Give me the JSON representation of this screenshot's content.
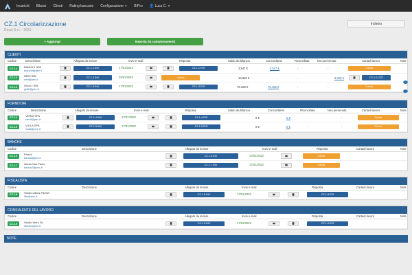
{
  "nav": {
    "items": [
      {
        "label": "Incarichi"
      },
      {
        "label": "Bilanci"
      },
      {
        "label": "Clienti"
      },
      {
        "label": "Rating bancario"
      },
      {
        "label": "Configurazione"
      },
      {
        "label": "BIPro"
      },
      {
        "label": "Luca C."
      }
    ]
  },
  "page": {
    "title": "CZ.1 Circolarizzazione",
    "subtitle": "Rossi S.r.l. - 2021",
    "back_label": "Indietro",
    "add_label": "+ Aggiungi",
    "import_label": "Importa da campionamenti"
  },
  "icons": {
    "doc": "document-icon",
    "mail": "envelope-icon",
    "comment": "comment-icon",
    "user": "user-icon"
  },
  "colors": {
    "navbar": "#2b2b2b",
    "panel_header": "#2a5f93",
    "code_green": "#2fa35a",
    "blue_btn": "#2a6099",
    "orange_btn": "#f0a030"
  },
  "clienti": {
    "header": "CLIENTI",
    "columns": {
      "codice": "Codice",
      "descrizione": "Descrizione",
      "allegato": "Allegato da inviare",
      "invio": "Invio e-mail",
      "risposta": "Risposta",
      "saldo": "Saldo da bilancio",
      "concordante": "Concordante",
      "riconciliata": "Riconciliata",
      "non_pervenuta": "Non pervenuta",
      "cartadi": "Cartadi lavoro",
      "note": "Note"
    },
    "rows": [
      {
        "code": "CZ.1.1",
        "name": "BIANCHI SPA",
        "email": "bianchi@pec.it",
        "inv": "CZ.1.1.INV",
        "date": "17/01/2022",
        "ris": "CZ.1.1.RIS",
        "saldo": "3.547 €",
        "conc": "3.547 €",
        "ric": "-",
        "np": "-",
        "carica": "Carica",
        "ris_pending": "",
        "crt": "",
        "has_note": false
      },
      {
        "code": "CZ.1.2",
        "name": "NERI SRL",
        "email": "neri@pec.it",
        "inv": "CZ.1.2.INV",
        "date": "25/01/2022",
        "ris": "",
        "saldo": "10.620 €",
        "conc": "-",
        "ric": "-",
        "np": "3.310 €",
        "carica": "",
        "ris_pending": "Carica",
        "crt": "CZ.1.2.CRT",
        "has_note": true
      },
      {
        "code": "CZ.1.3",
        "name": "GIALLI SRL",
        "email": "gialli@pec.it",
        "inv": "CZ.1.3.INV",
        "date": "17/01/2022",
        "ris": "CZ.1.3.RIS",
        "saldo": "75.159 €",
        "conc": "75.159 €",
        "ric": "-",
        "np": "-",
        "carica": "Carica",
        "ris_pending": "",
        "crt": "",
        "has_note": true
      }
    ]
  },
  "fornitori": {
    "header": "FORNITORI",
    "columns": {
      "codice": "Codice",
      "descrizione": "Descrizione",
      "allegato": "Allegato da inviare",
      "invio": "Invio e-mail",
      "risposta": "Risposta",
      "saldo": "Saldo da bilancio",
      "concordante": "Concordante",
      "riconciliata": "Riconciliata",
      "non_pervenuta": "Non pervenuta",
      "cartadi": "Cartadi lavoro",
      "note": "Note"
    },
    "rows": [
      {
        "code": "CZ.1.4",
        "name": "VERDI SPA",
        "email": "verdi@pec.it",
        "inv": "CZ.1.4.INV",
        "date": "17/01/2022",
        "ris": "CZ.1.4.RIS",
        "saldo": "0 €",
        "conc": "0 €",
        "ric": "-",
        "np": "-",
        "carica": "Carica"
      },
      {
        "code": "CZ.1.5",
        "name": "VIOLA SPA",
        "email": "viola@pec.it",
        "inv": "CZ.1.5.INV",
        "date": "17/01/2022",
        "ris": "CZ.1.5.RIS",
        "saldo": "0 €",
        "conc": "0 €",
        "ric": "-",
        "np": "-",
        "carica": "Carica"
      }
    ]
  },
  "banche": {
    "header": "BANCHE",
    "columns": {
      "codice": "Codice",
      "descrizione": "Descrizione",
      "allegato": "Allegato da inviare",
      "invio": "Invio e-mail",
      "risposta": "Risposta",
      "cartadi": "Cartadi lavoro",
      "note": "Note"
    },
    "rows": [
      {
        "code": "CZ.1.6",
        "name": "Fineco",
        "email": "banca@pec.it",
        "inv": "CZ.1.6.INV",
        "date": "17/01/2022",
        "carica": "Carica"
      },
      {
        "code": "CZ.1.7",
        "name": "Intesa San Paolo",
        "email": "banca2@pec.it",
        "inv": "CZ.1.7.INV",
        "date": "17/01/2022",
        "carica": "Carica"
      }
    ]
  },
  "fiscalista": {
    "header": "FISCALISTA",
    "columns": {
      "codice": "Codice",
      "descrizione": "Descrizione",
      "allegato": "Allegato da inviare",
      "invio": "Invio e-mail",
      "risposta": "Risposta",
      "cartadi": "Cartadi lavoro",
      "note": "Note"
    },
    "rows": [
      {
        "code": "CZ.1.8",
        "name": "Studio Lilla & Partner",
        "email": "lilla@pec.it",
        "inv": "CZ.1.8.INV",
        "date": "17/01/2022",
        "ris": "CZ.1.8.RIS"
      }
    ]
  },
  "consulente": {
    "header": "CONSULENTE DEL LAVORO",
    "columns": {
      "codice": "Codice",
      "descrizione": "Descrizione",
      "allegato": "Allegato da inviare",
      "invio": "Invio e-mail",
      "risposta": "Risposta",
      "cartadi": "Cartadi lavoro",
      "note": "Note"
    },
    "rows": [
      {
        "code": "CZ.1.9",
        "name": "Studio Work Srl",
        "email": "studio@pec.it",
        "inv": "CZ.1.9.INV",
        "date": "17/01/2022",
        "ris": "CZ.1.9.RIS"
      }
    ]
  },
  "note": {
    "header": "NOTE"
  }
}
